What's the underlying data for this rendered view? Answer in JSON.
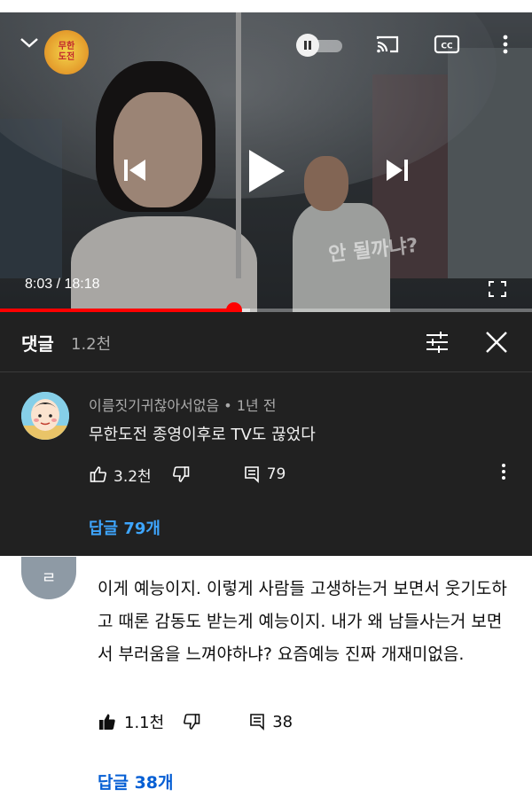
{
  "player": {
    "channel_logo_text": "무한\n도전",
    "current_time": "8:03",
    "time_separator": " / ",
    "duration": "18:18",
    "progress_fraction": 0.44,
    "loaded_fraction": 0.47,
    "caption_overlay": "안 될까냐?",
    "icons": [
      "chevron-down-icon",
      "pause-icon",
      "cast-icon",
      "cc-icon",
      "more-vert-icon",
      "skip-previous-icon",
      "play-icon",
      "skip-next-icon",
      "fullscreen-icon"
    ],
    "accent_color": "#ff0000"
  },
  "comments_panel": {
    "title": "댓글",
    "count": "1.2천",
    "top_comment": {
      "author": "이름짓기귀찮아서없음",
      "age": " • 1년 전",
      "text": "무한도전 종영이후로 TV도 끊었다",
      "likes": "3.2천",
      "reply_count": "79",
      "replies_link": "답글 79개"
    }
  },
  "second_comment": {
    "avatar_letter": "ㄹ",
    "text": "이게 예능이지. 이렇게 사람들 고생하는거 보면서 웃기도하고 때론 감동도 받는게 예능이지. 내가 왜 남들사는거 보면서 부러움을 느껴야하냐? 요즘예능 진짜 개재미없음.",
    "likes": "1.1천",
    "reply_count": "38",
    "replies_link": "답글 38개"
  }
}
